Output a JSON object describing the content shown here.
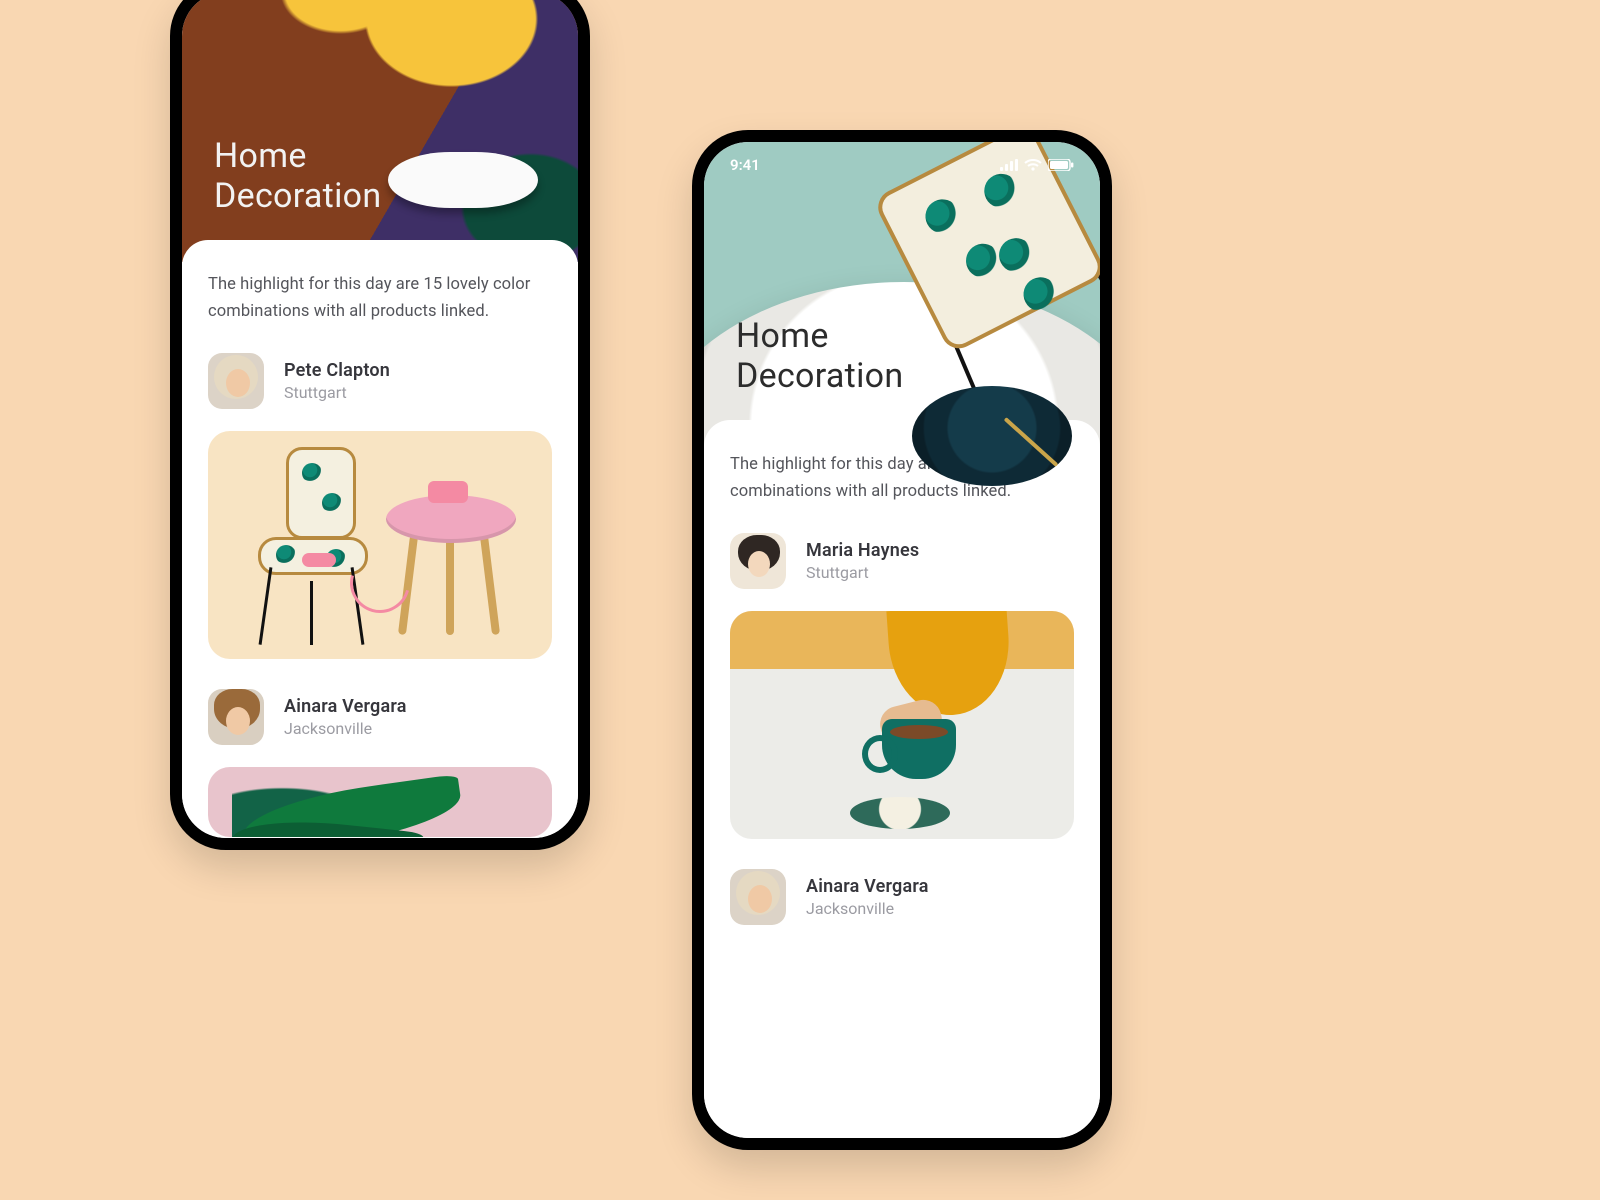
{
  "status": {
    "time": "9:41"
  },
  "phones": {
    "left": {
      "hero_title_line1": "Home",
      "hero_title_line2": "Decoration",
      "highlight": "The highlight for this day are 15 lovely color combinations with all products linked.",
      "users": [
        {
          "name": "Pete Clapton",
          "location": "Stuttgart"
        },
        {
          "name": "Ainara Vergara",
          "location": "Jacksonville"
        }
      ]
    },
    "right": {
      "hero_title_line1": "Home",
      "hero_title_line2": "Decoration",
      "highlight": "The highlight for this day are 15 lovely color combinations with all products linked.",
      "users": [
        {
          "name": "Maria Haynes",
          "location": "Stuttgart"
        },
        {
          "name": "Ainara Vergara",
          "location": "Jacksonville"
        }
      ]
    }
  }
}
